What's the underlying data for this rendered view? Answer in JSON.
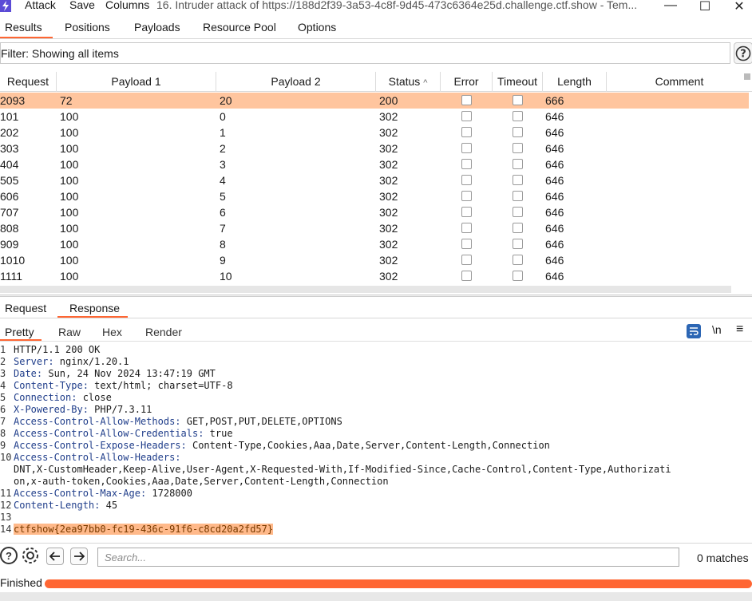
{
  "titlebar": {
    "menu": [
      "Attack",
      "Save",
      "Columns"
    ],
    "title": "16. Intruder attack of https://188d2f39-3a53-4c8f-9d45-473c6364e25d.challenge.ctf.show - Tem..."
  },
  "main_tabs": [
    "Results",
    "Positions",
    "Payloads",
    "Resource Pool",
    "Options"
  ],
  "active_main_tab": "Results",
  "filter": {
    "text": "Filter: Showing all items"
  },
  "table": {
    "columns": [
      "Request",
      "Payload 1",
      "Payload 2",
      "Status",
      "Error",
      "Timeout",
      "Length",
      "Comment"
    ],
    "sort_indicator": "^",
    "rows": [
      {
        "request": "2093",
        "payload1": "72",
        "payload2": "20",
        "status": "200",
        "error": false,
        "timeout": false,
        "length": "666",
        "comment": "",
        "selected": true
      },
      {
        "request": "101",
        "payload1": "100",
        "payload2": "0",
        "status": "302",
        "error": false,
        "timeout": false,
        "length": "646",
        "comment": "",
        "selected": false
      },
      {
        "request": "202",
        "payload1": "100",
        "payload2": "1",
        "status": "302",
        "error": false,
        "timeout": false,
        "length": "646",
        "comment": "",
        "selected": false
      },
      {
        "request": "303",
        "payload1": "100",
        "payload2": "2",
        "status": "302",
        "error": false,
        "timeout": false,
        "length": "646",
        "comment": "",
        "selected": false
      },
      {
        "request": "404",
        "payload1": "100",
        "payload2": "3",
        "status": "302",
        "error": false,
        "timeout": false,
        "length": "646",
        "comment": "",
        "selected": false
      },
      {
        "request": "505",
        "payload1": "100",
        "payload2": "4",
        "status": "302",
        "error": false,
        "timeout": false,
        "length": "646",
        "comment": "",
        "selected": false
      },
      {
        "request": "606",
        "payload1": "100",
        "payload2": "5",
        "status": "302",
        "error": false,
        "timeout": false,
        "length": "646",
        "comment": "",
        "selected": false
      },
      {
        "request": "707",
        "payload1": "100",
        "payload2": "6",
        "status": "302",
        "error": false,
        "timeout": false,
        "length": "646",
        "comment": "",
        "selected": false
      },
      {
        "request": "808",
        "payload1": "100",
        "payload2": "7",
        "status": "302",
        "error": false,
        "timeout": false,
        "length": "646",
        "comment": "",
        "selected": false
      },
      {
        "request": "909",
        "payload1": "100",
        "payload2": "8",
        "status": "302",
        "error": false,
        "timeout": false,
        "length": "646",
        "comment": "",
        "selected": false
      },
      {
        "request": "1010",
        "payload1": "100",
        "payload2": "9",
        "status": "302",
        "error": false,
        "timeout": false,
        "length": "646",
        "comment": "",
        "selected": false
      },
      {
        "request": "1111",
        "payload1": "100",
        "payload2": "10",
        "status": "302",
        "error": false,
        "timeout": false,
        "length": "646",
        "comment": "",
        "selected": false
      }
    ]
  },
  "message_tabs": [
    "Request",
    "Response"
  ],
  "active_message_tab": "Response",
  "view_tabs": [
    "Pretty",
    "Raw",
    "Hex",
    "Render"
  ],
  "active_view_tab": "Pretty",
  "view_tools": {
    "newline_label": "\\n",
    "menu_label": "≡"
  },
  "response_lines": [
    {
      "n": "1",
      "name": "",
      "value": "HTTP/1.1 200 OK"
    },
    {
      "n": "2",
      "name": "Server:",
      "value": " nginx/1.20.1"
    },
    {
      "n": "3",
      "name": "Date:",
      "value": " Sun, 24 Nov 2024 13:47:19 GMT"
    },
    {
      "n": "4",
      "name": "Content-Type:",
      "value": " text/html; charset=UTF-8"
    },
    {
      "n": "5",
      "name": "Connection:",
      "value": " close"
    },
    {
      "n": "6",
      "name": "X-Powered-By:",
      "value": " PHP/7.3.11"
    },
    {
      "n": "7",
      "name": "Access-Control-Allow-Methods:",
      "value": " GET,POST,PUT,DELETE,OPTIONS"
    },
    {
      "n": "8",
      "name": "Access-Control-Allow-Credentials:",
      "value": " true"
    },
    {
      "n": "9",
      "name": "Access-Control-Expose-Headers:",
      "value": " Content-Type,Cookies,Aaa,Date,Server,Content-Length,Connection"
    },
    {
      "n": "10",
      "name": "Access-Control-Allow-Headers:",
      "value": ""
    },
    {
      "n": "",
      "name": "",
      "value": "DNT,X-CustomHeader,Keep-Alive,User-Agent,X-Requested-With,If-Modified-Since,Cache-Control,Content-Type,Authorizati"
    },
    {
      "n": "",
      "name": "",
      "value": "on,x-auth-token,Cookies,Aaa,Date,Server,Content-Length,Connection"
    },
    {
      "n": "11",
      "name": "Access-Control-Max-Age:",
      "value": " 1728000"
    },
    {
      "n": "12",
      "name": "Content-Length:",
      "value": " 45"
    },
    {
      "n": "13",
      "name": "",
      "value": ""
    },
    {
      "n": "14",
      "name": "",
      "value": "ctfshow{2ea97bb0-fc19-436c-91f6-c8cd20a2fd57}",
      "highlight": true
    }
  ],
  "search": {
    "placeholder": "Search...",
    "matches": "0 matches"
  },
  "status": {
    "text": "Finished",
    "progress": 1.0
  },
  "colors": {
    "accent": "#ff6633",
    "selected_row": "#ffc59e",
    "header_name": "#1f3d8a",
    "flag_highlight": "#ffb98a",
    "wrap_button": "#2c66b4"
  },
  "icons": {
    "app": "burp-logo-icon",
    "help": "help-icon",
    "settings": "gear-icon",
    "back": "arrow-left-icon",
    "forward": "arrow-right-icon",
    "wrap": "wrap-lines-icon"
  }
}
